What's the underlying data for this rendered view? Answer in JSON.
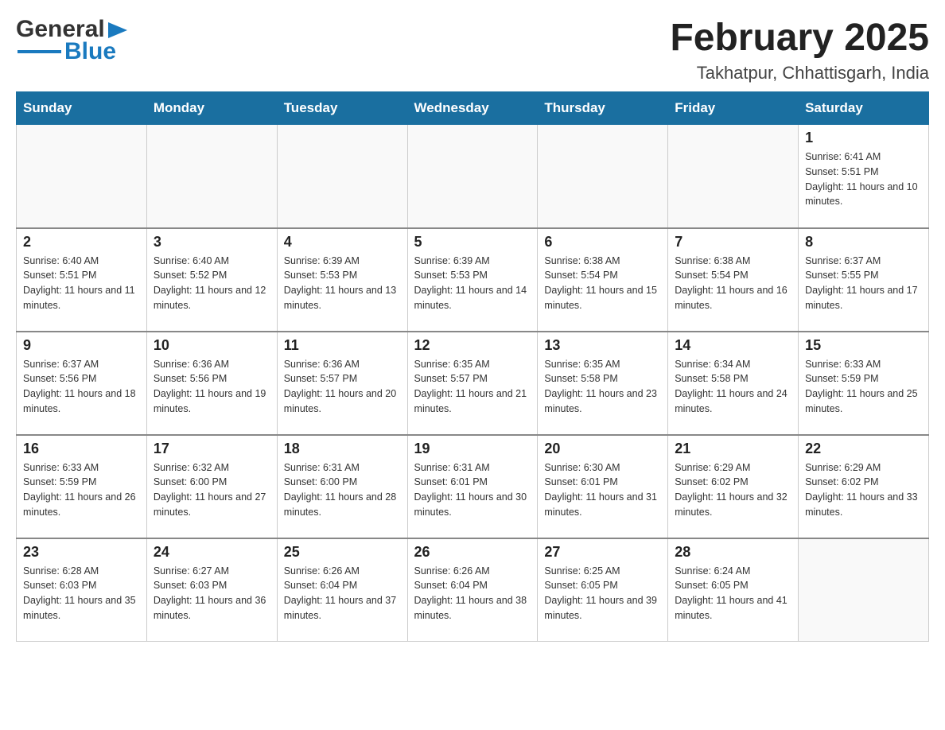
{
  "header": {
    "logo_general": "General",
    "logo_blue": "Blue",
    "month": "February 2025",
    "location": "Takhatpur, Chhattisgarh, India"
  },
  "weekdays": [
    "Sunday",
    "Monday",
    "Tuesday",
    "Wednesday",
    "Thursday",
    "Friday",
    "Saturday"
  ],
  "weeks": [
    [
      {
        "day": "",
        "sunrise": "",
        "sunset": "",
        "daylight": ""
      },
      {
        "day": "",
        "sunrise": "",
        "sunset": "",
        "daylight": ""
      },
      {
        "day": "",
        "sunrise": "",
        "sunset": "",
        "daylight": ""
      },
      {
        "day": "",
        "sunrise": "",
        "sunset": "",
        "daylight": ""
      },
      {
        "day": "",
        "sunrise": "",
        "sunset": "",
        "daylight": ""
      },
      {
        "day": "",
        "sunrise": "",
        "sunset": "",
        "daylight": ""
      },
      {
        "day": "1",
        "sunrise": "Sunrise: 6:41 AM",
        "sunset": "Sunset: 5:51 PM",
        "daylight": "Daylight: 11 hours and 10 minutes."
      }
    ],
    [
      {
        "day": "2",
        "sunrise": "Sunrise: 6:40 AM",
        "sunset": "Sunset: 5:51 PM",
        "daylight": "Daylight: 11 hours and 11 minutes."
      },
      {
        "day": "3",
        "sunrise": "Sunrise: 6:40 AM",
        "sunset": "Sunset: 5:52 PM",
        "daylight": "Daylight: 11 hours and 12 minutes."
      },
      {
        "day": "4",
        "sunrise": "Sunrise: 6:39 AM",
        "sunset": "Sunset: 5:53 PM",
        "daylight": "Daylight: 11 hours and 13 minutes."
      },
      {
        "day": "5",
        "sunrise": "Sunrise: 6:39 AM",
        "sunset": "Sunset: 5:53 PM",
        "daylight": "Daylight: 11 hours and 14 minutes."
      },
      {
        "day": "6",
        "sunrise": "Sunrise: 6:38 AM",
        "sunset": "Sunset: 5:54 PM",
        "daylight": "Daylight: 11 hours and 15 minutes."
      },
      {
        "day": "7",
        "sunrise": "Sunrise: 6:38 AM",
        "sunset": "Sunset: 5:54 PM",
        "daylight": "Daylight: 11 hours and 16 minutes."
      },
      {
        "day": "8",
        "sunrise": "Sunrise: 6:37 AM",
        "sunset": "Sunset: 5:55 PM",
        "daylight": "Daylight: 11 hours and 17 minutes."
      }
    ],
    [
      {
        "day": "9",
        "sunrise": "Sunrise: 6:37 AM",
        "sunset": "Sunset: 5:56 PM",
        "daylight": "Daylight: 11 hours and 18 minutes."
      },
      {
        "day": "10",
        "sunrise": "Sunrise: 6:36 AM",
        "sunset": "Sunset: 5:56 PM",
        "daylight": "Daylight: 11 hours and 19 minutes."
      },
      {
        "day": "11",
        "sunrise": "Sunrise: 6:36 AM",
        "sunset": "Sunset: 5:57 PM",
        "daylight": "Daylight: 11 hours and 20 minutes."
      },
      {
        "day": "12",
        "sunrise": "Sunrise: 6:35 AM",
        "sunset": "Sunset: 5:57 PM",
        "daylight": "Daylight: 11 hours and 21 minutes."
      },
      {
        "day": "13",
        "sunrise": "Sunrise: 6:35 AM",
        "sunset": "Sunset: 5:58 PM",
        "daylight": "Daylight: 11 hours and 23 minutes."
      },
      {
        "day": "14",
        "sunrise": "Sunrise: 6:34 AM",
        "sunset": "Sunset: 5:58 PM",
        "daylight": "Daylight: 11 hours and 24 minutes."
      },
      {
        "day": "15",
        "sunrise": "Sunrise: 6:33 AM",
        "sunset": "Sunset: 5:59 PM",
        "daylight": "Daylight: 11 hours and 25 minutes."
      }
    ],
    [
      {
        "day": "16",
        "sunrise": "Sunrise: 6:33 AM",
        "sunset": "Sunset: 5:59 PM",
        "daylight": "Daylight: 11 hours and 26 minutes."
      },
      {
        "day": "17",
        "sunrise": "Sunrise: 6:32 AM",
        "sunset": "Sunset: 6:00 PM",
        "daylight": "Daylight: 11 hours and 27 minutes."
      },
      {
        "day": "18",
        "sunrise": "Sunrise: 6:31 AM",
        "sunset": "Sunset: 6:00 PM",
        "daylight": "Daylight: 11 hours and 28 minutes."
      },
      {
        "day": "19",
        "sunrise": "Sunrise: 6:31 AM",
        "sunset": "Sunset: 6:01 PM",
        "daylight": "Daylight: 11 hours and 30 minutes."
      },
      {
        "day": "20",
        "sunrise": "Sunrise: 6:30 AM",
        "sunset": "Sunset: 6:01 PM",
        "daylight": "Daylight: 11 hours and 31 minutes."
      },
      {
        "day": "21",
        "sunrise": "Sunrise: 6:29 AM",
        "sunset": "Sunset: 6:02 PM",
        "daylight": "Daylight: 11 hours and 32 minutes."
      },
      {
        "day": "22",
        "sunrise": "Sunrise: 6:29 AM",
        "sunset": "Sunset: 6:02 PM",
        "daylight": "Daylight: 11 hours and 33 minutes."
      }
    ],
    [
      {
        "day": "23",
        "sunrise": "Sunrise: 6:28 AM",
        "sunset": "Sunset: 6:03 PM",
        "daylight": "Daylight: 11 hours and 35 minutes."
      },
      {
        "day": "24",
        "sunrise": "Sunrise: 6:27 AM",
        "sunset": "Sunset: 6:03 PM",
        "daylight": "Daylight: 11 hours and 36 minutes."
      },
      {
        "day": "25",
        "sunrise": "Sunrise: 6:26 AM",
        "sunset": "Sunset: 6:04 PM",
        "daylight": "Daylight: 11 hours and 37 minutes."
      },
      {
        "day": "26",
        "sunrise": "Sunrise: 6:26 AM",
        "sunset": "Sunset: 6:04 PM",
        "daylight": "Daylight: 11 hours and 38 minutes."
      },
      {
        "day": "27",
        "sunrise": "Sunrise: 6:25 AM",
        "sunset": "Sunset: 6:05 PM",
        "daylight": "Daylight: 11 hours and 39 minutes."
      },
      {
        "day": "28",
        "sunrise": "Sunrise: 6:24 AM",
        "sunset": "Sunset: 6:05 PM",
        "daylight": "Daylight: 11 hours and 41 minutes."
      },
      {
        "day": "",
        "sunrise": "",
        "sunset": "",
        "daylight": ""
      }
    ]
  ]
}
